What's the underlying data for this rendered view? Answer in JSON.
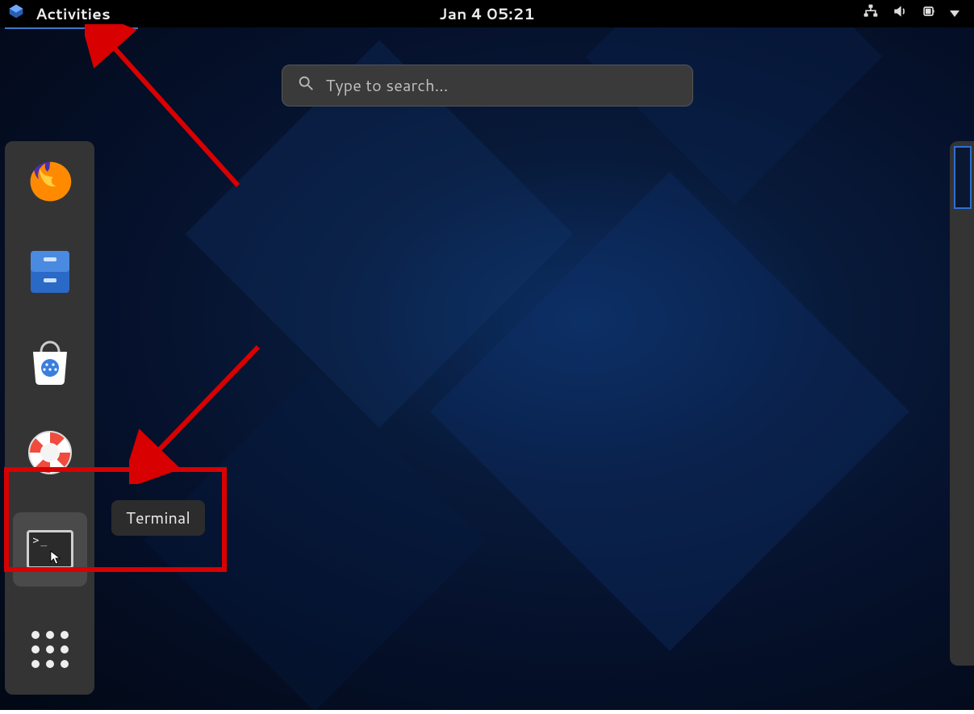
{
  "topbar": {
    "activities_label": "Activities",
    "datetime": "Jan 4  05:21"
  },
  "search": {
    "placeholder": "Type to search..."
  },
  "dock": {
    "items": [
      {
        "name": "firefox",
        "label": "Firefox"
      },
      {
        "name": "files",
        "label": "Files"
      },
      {
        "name": "software",
        "label": "Software"
      },
      {
        "name": "help",
        "label": "Help"
      },
      {
        "name": "terminal",
        "label": "Terminal"
      },
      {
        "name": "apps",
        "label": "Show Applications"
      }
    ]
  },
  "tooltip": {
    "label": "Terminal"
  },
  "colors": {
    "annotation": "#d80000",
    "accent": "#3c78c8"
  }
}
